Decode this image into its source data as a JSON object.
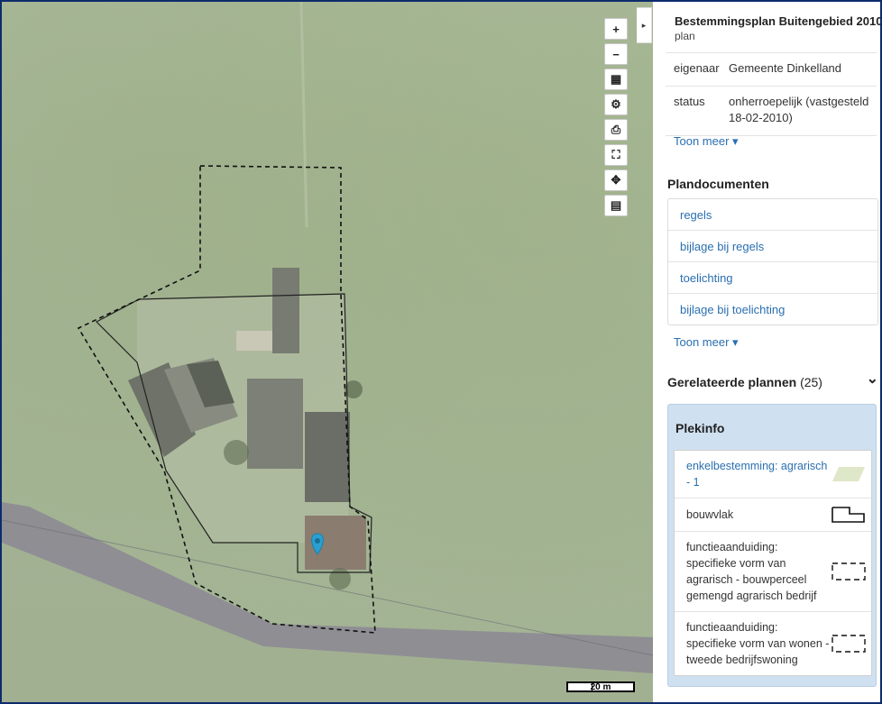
{
  "map": {
    "zoom_in_label": "+",
    "zoom_out_label": "−",
    "scale_label": "20 m",
    "collapse_glyph": "▸",
    "tools": [
      {
        "icon": "ruler-icon",
        "glyph": "▦"
      },
      {
        "icon": "gear-icon",
        "glyph": "⚙"
      },
      {
        "icon": "print-icon",
        "glyph": "⎙"
      },
      {
        "icon": "fullscreen-icon",
        "glyph": "⛶"
      },
      {
        "icon": "locate-icon",
        "glyph": "✥"
      },
      {
        "icon": "legend-icon",
        "glyph": "▤"
      }
    ],
    "marker_color": "#2a9fd0"
  },
  "panel": {
    "title": "Bestemmingsplan Buitengebied 2010",
    "cut_text": "plan",
    "meta": [
      {
        "key": "eigenaar",
        "value": "Gemeente Dinkelland"
      },
      {
        "key": "status",
        "value": "onherroepelijk (vastgesteld 18-02-2010)"
      }
    ],
    "toon_meer_1": "Toon meer ▾",
    "plandocumenten_heading": "Plandocumenten",
    "documents": [
      "regels",
      "bijlage bij regels",
      "toelichting",
      "bijlage bij toelichting"
    ],
    "toon_meer_2": "Toon meer ▾",
    "related_heading": "Gerelateerde plannen",
    "related_count": "(25)",
    "related_chevron": "⌄",
    "plekinfo_heading": "Plekinfo",
    "plekinfo": [
      {
        "label": "enkelbestemming: agrarisch - 1",
        "link": true,
        "symbol": "parallelogram-green"
      },
      {
        "label": "bouwvlak",
        "link": false,
        "symbol": "outline-shape"
      },
      {
        "label": "functieaanduiding: specifieke vorm van agrarisch - bouwperceel gemengd agrarisch bedrijf",
        "link": false,
        "symbol": "dashed-rect"
      },
      {
        "label": "functieaanduiding: specifieke vorm van wonen - tweede bedrijfswoning",
        "link": false,
        "symbol": "dashed-rect"
      }
    ]
  }
}
